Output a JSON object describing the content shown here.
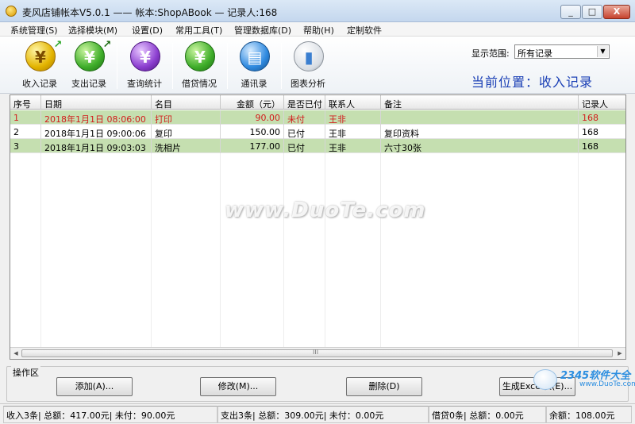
{
  "window": {
    "title": "麦风店铺帐本V5.0.1  ——  帐本:ShopABook — 记录人:168",
    "minimize": "_",
    "maximize": "□",
    "close": "X"
  },
  "menu": [
    "系统管理(S)",
    "选择模块(M)",
    "设置(D)",
    "常用工具(T)",
    "管理数据库(D)",
    "帮助(H)",
    "定制软件"
  ],
  "toolbar": {
    "items": [
      {
        "label": "收入记录",
        "icon": "income-icon",
        "glyph": "¥"
      },
      {
        "label": "支出记录",
        "icon": "expense-icon",
        "glyph": "¥"
      },
      {
        "label": "查询统计",
        "icon": "search-stats-icon",
        "glyph": "¥"
      },
      {
        "label": "借贷情况",
        "icon": "loan-icon",
        "glyph": "¥"
      },
      {
        "label": "通讯录",
        "icon": "contacts-icon",
        "glyph": "▤"
      },
      {
        "label": "图表分析",
        "icon": "chart-icon",
        "glyph": "▮"
      }
    ]
  },
  "range": {
    "label": "显示范围:",
    "value": "所有记录"
  },
  "location": "当前位置：收入记录",
  "table": {
    "columns": [
      "序号",
      "日期",
      "名目",
      "金额（元）",
      "是否已付",
      "联系人",
      "备注",
      "记录人"
    ],
    "rows": [
      [
        "1",
        "2018年1月1日 08:06:00",
        "打印",
        "90.00",
        "未付",
        "王非",
        "",
        "168"
      ],
      [
        "2",
        "2018年1月1日 09:00:06",
        "复印",
        "150.00",
        "已付",
        "王非",
        "复印资料",
        "168"
      ],
      [
        "3",
        "2018年1月1日 09:03:03",
        "洗相片",
        "177.00",
        "已付",
        "王非",
        "六寸30张",
        "168"
      ]
    ],
    "scroll_grip": "III"
  },
  "watermark": "www.DuoTe.com",
  "ops": {
    "label": "操作区",
    "add": "添加(A)...",
    "edit": "修改(M)...",
    "delete": "删除(D)",
    "excel": "生成Excel表(E)..."
  },
  "logo": {
    "big": "2345软件大全",
    "small": "www.DuoTe.com"
  },
  "status": {
    "income": "收入3条| 总额：417.00元| 未付：90.00元",
    "expense": "支出3条| 总额：309.00元| 未付：0.00元",
    "loan": "借贷0条| 总额：0.00元",
    "balance": "余额：108.00元"
  },
  "colors": {
    "row_highlight": "#c5dfb0",
    "unpaid_text": "#d21c1c",
    "location_text": "#1a3fb5"
  }
}
